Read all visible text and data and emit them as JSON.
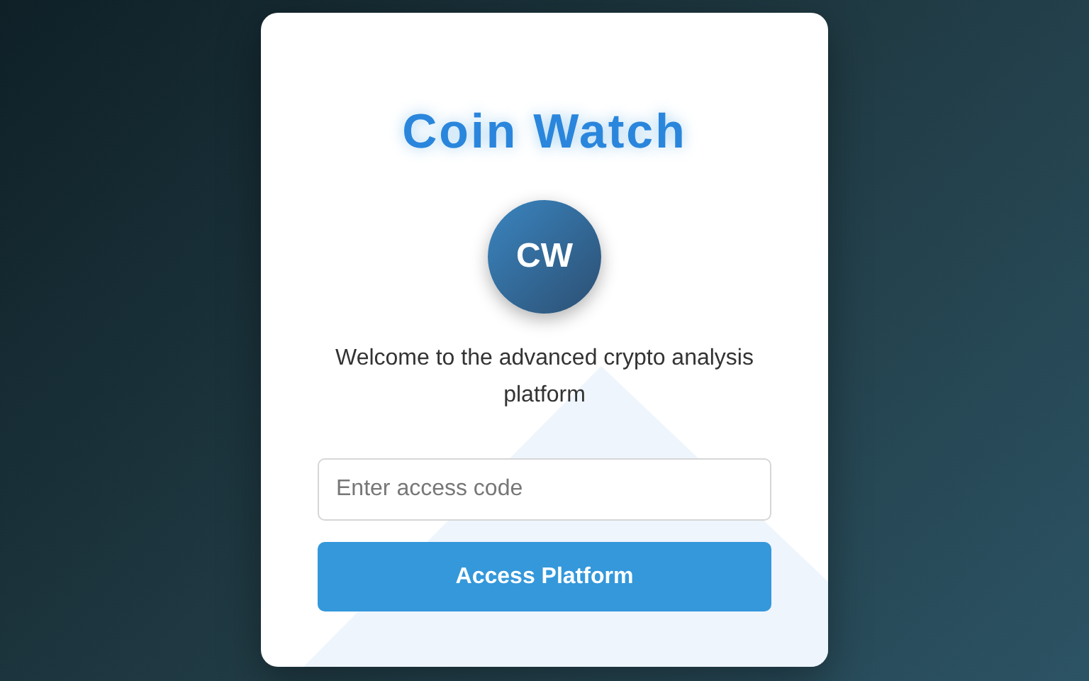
{
  "title": "Coin Watch",
  "logo": "CW",
  "welcome": "Welcome to the advanced crypto analysis platform",
  "access_field": {
    "placeholder": "Enter access code"
  },
  "button": "Access Platform"
}
